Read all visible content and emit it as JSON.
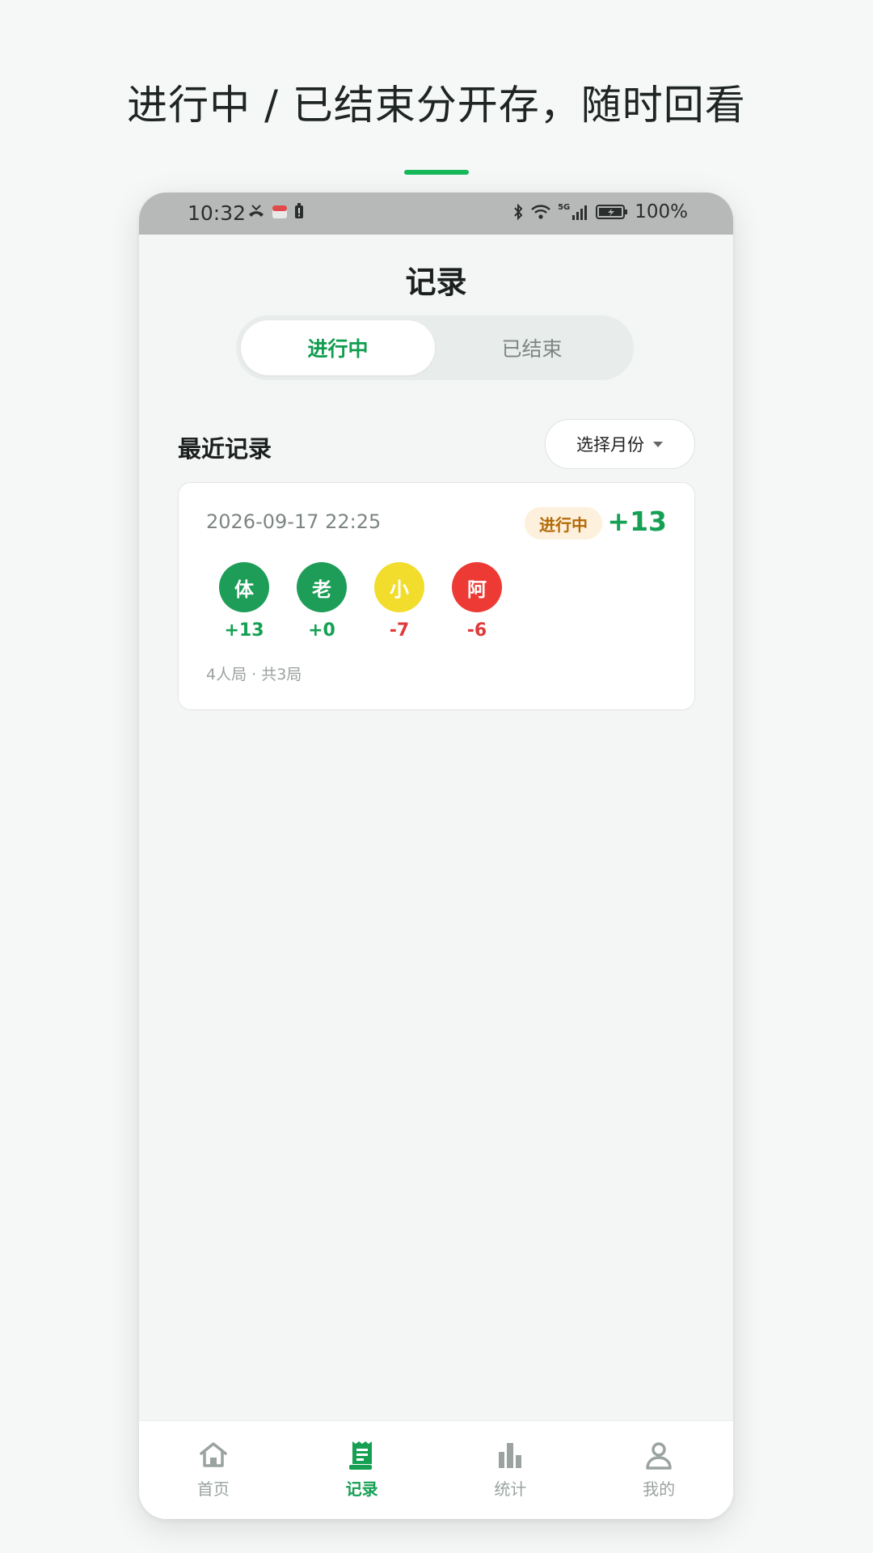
{
  "headline": "进行中 / 已结束分开存，随时回看",
  "status_bar": {
    "time": "10:32",
    "battery_percent": "100%",
    "network_label": "5G"
  },
  "header": {
    "title": "记录"
  },
  "segmented": {
    "active_label": "进行中",
    "inactive_label": "已结束"
  },
  "section": {
    "title": "最近记录",
    "month_select_label": "选择月份"
  },
  "record": {
    "date": "2026-09-17 22:25",
    "badge": "进行中",
    "total": "+13",
    "players": [
      {
        "initial": "体",
        "score": "+13",
        "avatar_color": "#1d9d57",
        "score_color": "#16a054"
      },
      {
        "initial": "老",
        "score": "+0",
        "avatar_color": "#1d9d57",
        "score_color": "#16a054"
      },
      {
        "initial": "小",
        "score": "-7",
        "avatar_color": "#f2dc2c",
        "score_color": "#e0393b"
      },
      {
        "initial": "阿",
        "score": "-6",
        "avatar_color": "#ee3a35",
        "score_color": "#e0393b"
      }
    ],
    "meta": "4人局 · 共3局"
  },
  "tabbar": {
    "items": [
      {
        "label": "首页",
        "icon": "home-icon"
      },
      {
        "label": "记录",
        "icon": "receipt-icon"
      },
      {
        "label": "统计",
        "icon": "bar-chart-icon"
      },
      {
        "label": "我的",
        "icon": "person-icon"
      }
    ]
  },
  "colors": {
    "accent": "#16b85a",
    "primary_green": "#16a054",
    "negative_red": "#e0393b",
    "badge_bg": "#fdf0dc",
    "badge_text": "#b46a05"
  }
}
